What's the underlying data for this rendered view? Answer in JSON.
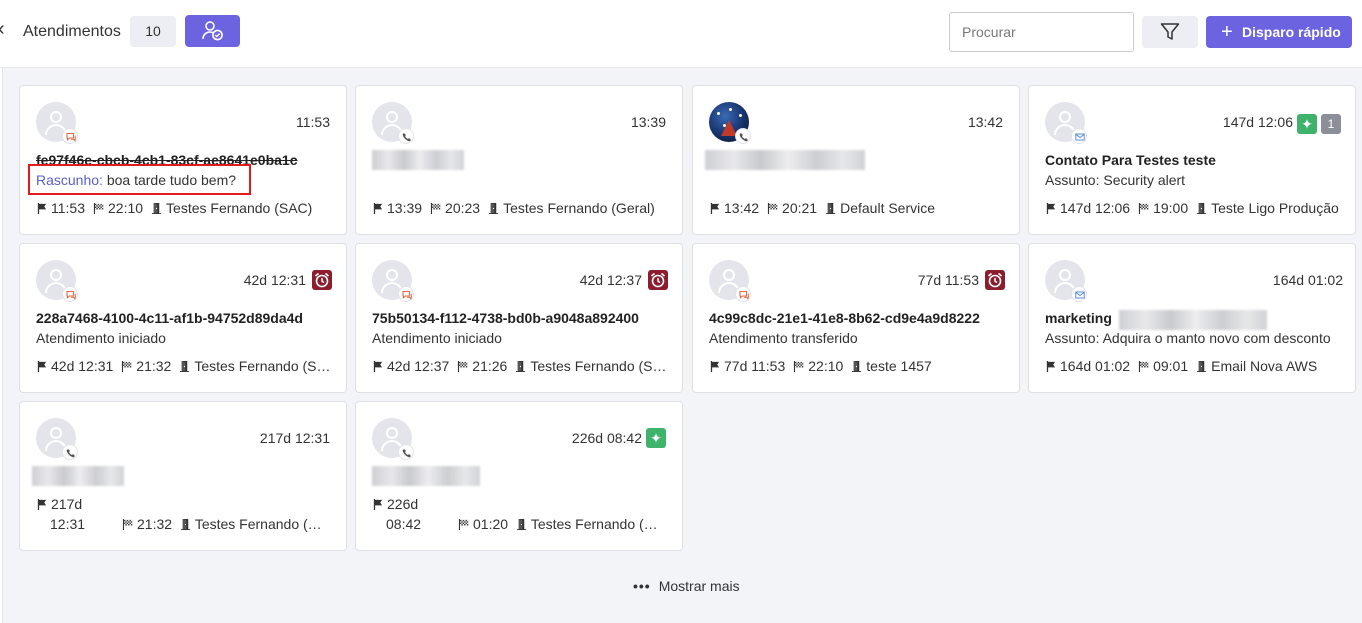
{
  "header": {
    "title": "Atendimentos",
    "count": "10",
    "search_placeholder": "Procurar",
    "quick_send_label": "Disparo rápido"
  },
  "colors": {
    "accent": "#6c63e0",
    "overdue": "#8b1e2e",
    "new": "#3fb36b",
    "draft": "#5a5fc9"
  },
  "cards": [
    {
      "name": "fe97f46e-cbcb-4cb1-83cf-ae8641e0ba1c",
      "time": "11:53",
      "draft_label": "Rascunho:",
      "draft_text": "boa tarde tudo bem?",
      "meta_start": "11:53",
      "meta_end": "22:10",
      "meta_dept": "Testes Fernando (SAC)",
      "channel": "chat-icon"
    },
    {
      "time": "13:39",
      "meta_start": "13:39",
      "meta_end": "20:23",
      "meta_dept": "Testes Fernando (Geral)",
      "channel": "phone-icon"
    },
    {
      "time": "13:42",
      "meta_start": "13:42",
      "meta_end": "20:21",
      "meta_dept": "Default Service",
      "channel": "phone-icon"
    },
    {
      "name": "Contato Para Testes teste",
      "time": "147d 12:06",
      "unread": "1",
      "subtitle": "Assunto: Security alert",
      "meta_start": "147d 12:06",
      "meta_end": "19:00",
      "meta_dept": "Teste Ligo Produção",
      "channel": "mail-icon"
    },
    {
      "name": "228a7468-4100-4c11-af1b-94752d89da4d",
      "time": "42d 12:31",
      "subtitle": "Atendimento iniciado",
      "meta_start": "42d 12:31",
      "meta_end": "21:32",
      "meta_dept": "Testes Fernando (SAC)",
      "channel": "chat-icon"
    },
    {
      "name": "75b50134-f112-4738-bd0b-a9048a892400",
      "time": "42d 12:37",
      "subtitle": "Atendimento iniciado",
      "meta_start": "42d 12:37",
      "meta_end": "21:26",
      "meta_dept": "Testes Fernando (SAC)",
      "channel": "chat-icon"
    },
    {
      "name": "4c99c8dc-21e1-41e8-8b62-cd9e4a9d8222",
      "time": "77d 11:53",
      "subtitle": "Atendimento transferido",
      "meta_start": "77d 11:53",
      "meta_end": "22:10",
      "meta_dept": "teste 1457",
      "channel": "chat-icon"
    },
    {
      "name": "marketing",
      "time": "164d 01:02",
      "subtitle": "Assunto: Adquira o manto novo com desconto",
      "meta_start": "164d 01:02",
      "meta_end": "09:01",
      "meta_dept": "Email Nova AWS",
      "channel": "mail-icon"
    },
    {
      "time": "217d 12:31",
      "meta_start_day": "217d",
      "meta_start_time": "12:31",
      "meta_end": "21:32",
      "meta_dept": "Testes Fernando (Geral)",
      "channel": "phone-icon"
    },
    {
      "time": "226d 08:42",
      "meta_start_day": "226d",
      "meta_start_time": "08:42",
      "meta_end": "01:20",
      "meta_dept": "Testes Fernando (Geral)",
      "channel": "phone-icon"
    }
  ],
  "footer": {
    "show_more": "Mostrar mais"
  }
}
